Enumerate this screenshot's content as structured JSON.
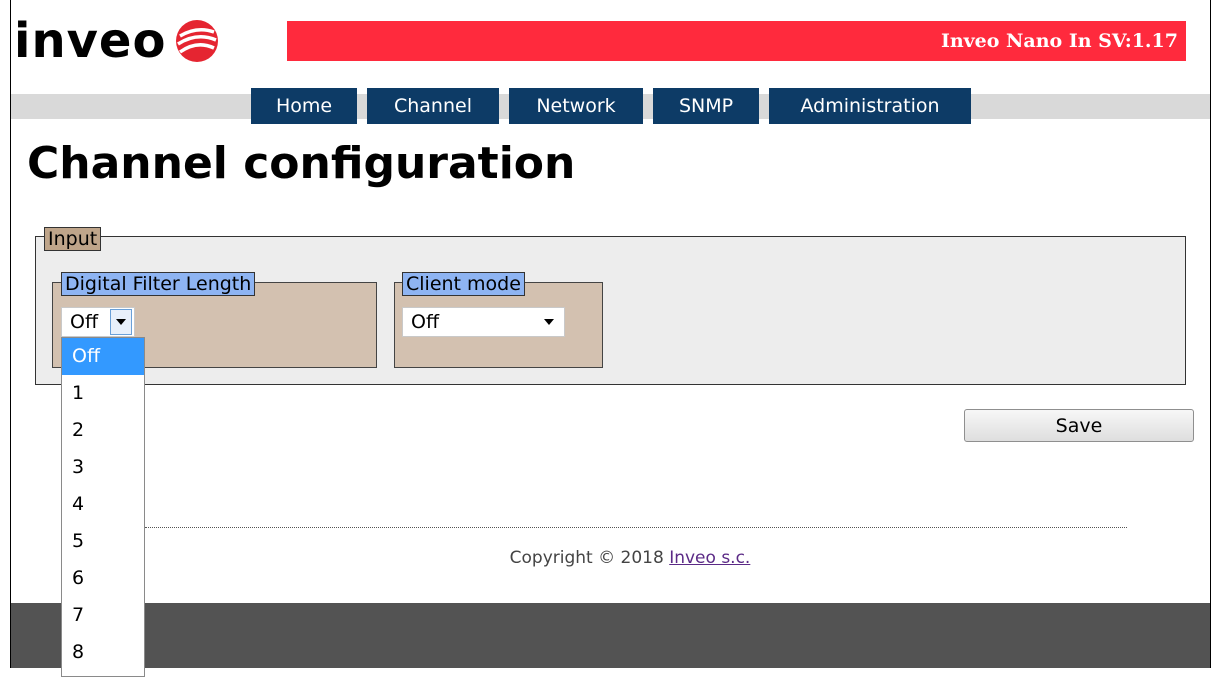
{
  "brand": {
    "logo_text": "inveo",
    "device_title": "Inveo Nano In SV:1.17"
  },
  "colors": {
    "header_red": "#ff2a3d",
    "nav_blue": "#0d3b66",
    "legend_tan": "#bfa58a",
    "legend_blue": "#8eb4f2",
    "panel_tan": "#d3c1b0",
    "footer_gray": "#535353",
    "selected_option": "#3399ff"
  },
  "nav": {
    "items": [
      {
        "label": "Home"
      },
      {
        "label": "Channel"
      },
      {
        "label": "Network"
      },
      {
        "label": "SNMP"
      },
      {
        "label": "Administration"
      }
    ]
  },
  "page": {
    "title": "Channel configuration"
  },
  "input_section": {
    "legend": "Input",
    "digital_filter": {
      "legend": "Digital Filter Length",
      "value": "Off",
      "options": [
        "Off",
        "1",
        "2",
        "3",
        "4",
        "5",
        "6",
        "7",
        "8"
      ],
      "selected_option": "Off"
    },
    "client_mode": {
      "legend": "Client mode",
      "value": "Off"
    }
  },
  "save_label": "Save",
  "footer": {
    "copyright_text": "Copyright © 2018",
    "company_link": "Inveo s.c."
  }
}
